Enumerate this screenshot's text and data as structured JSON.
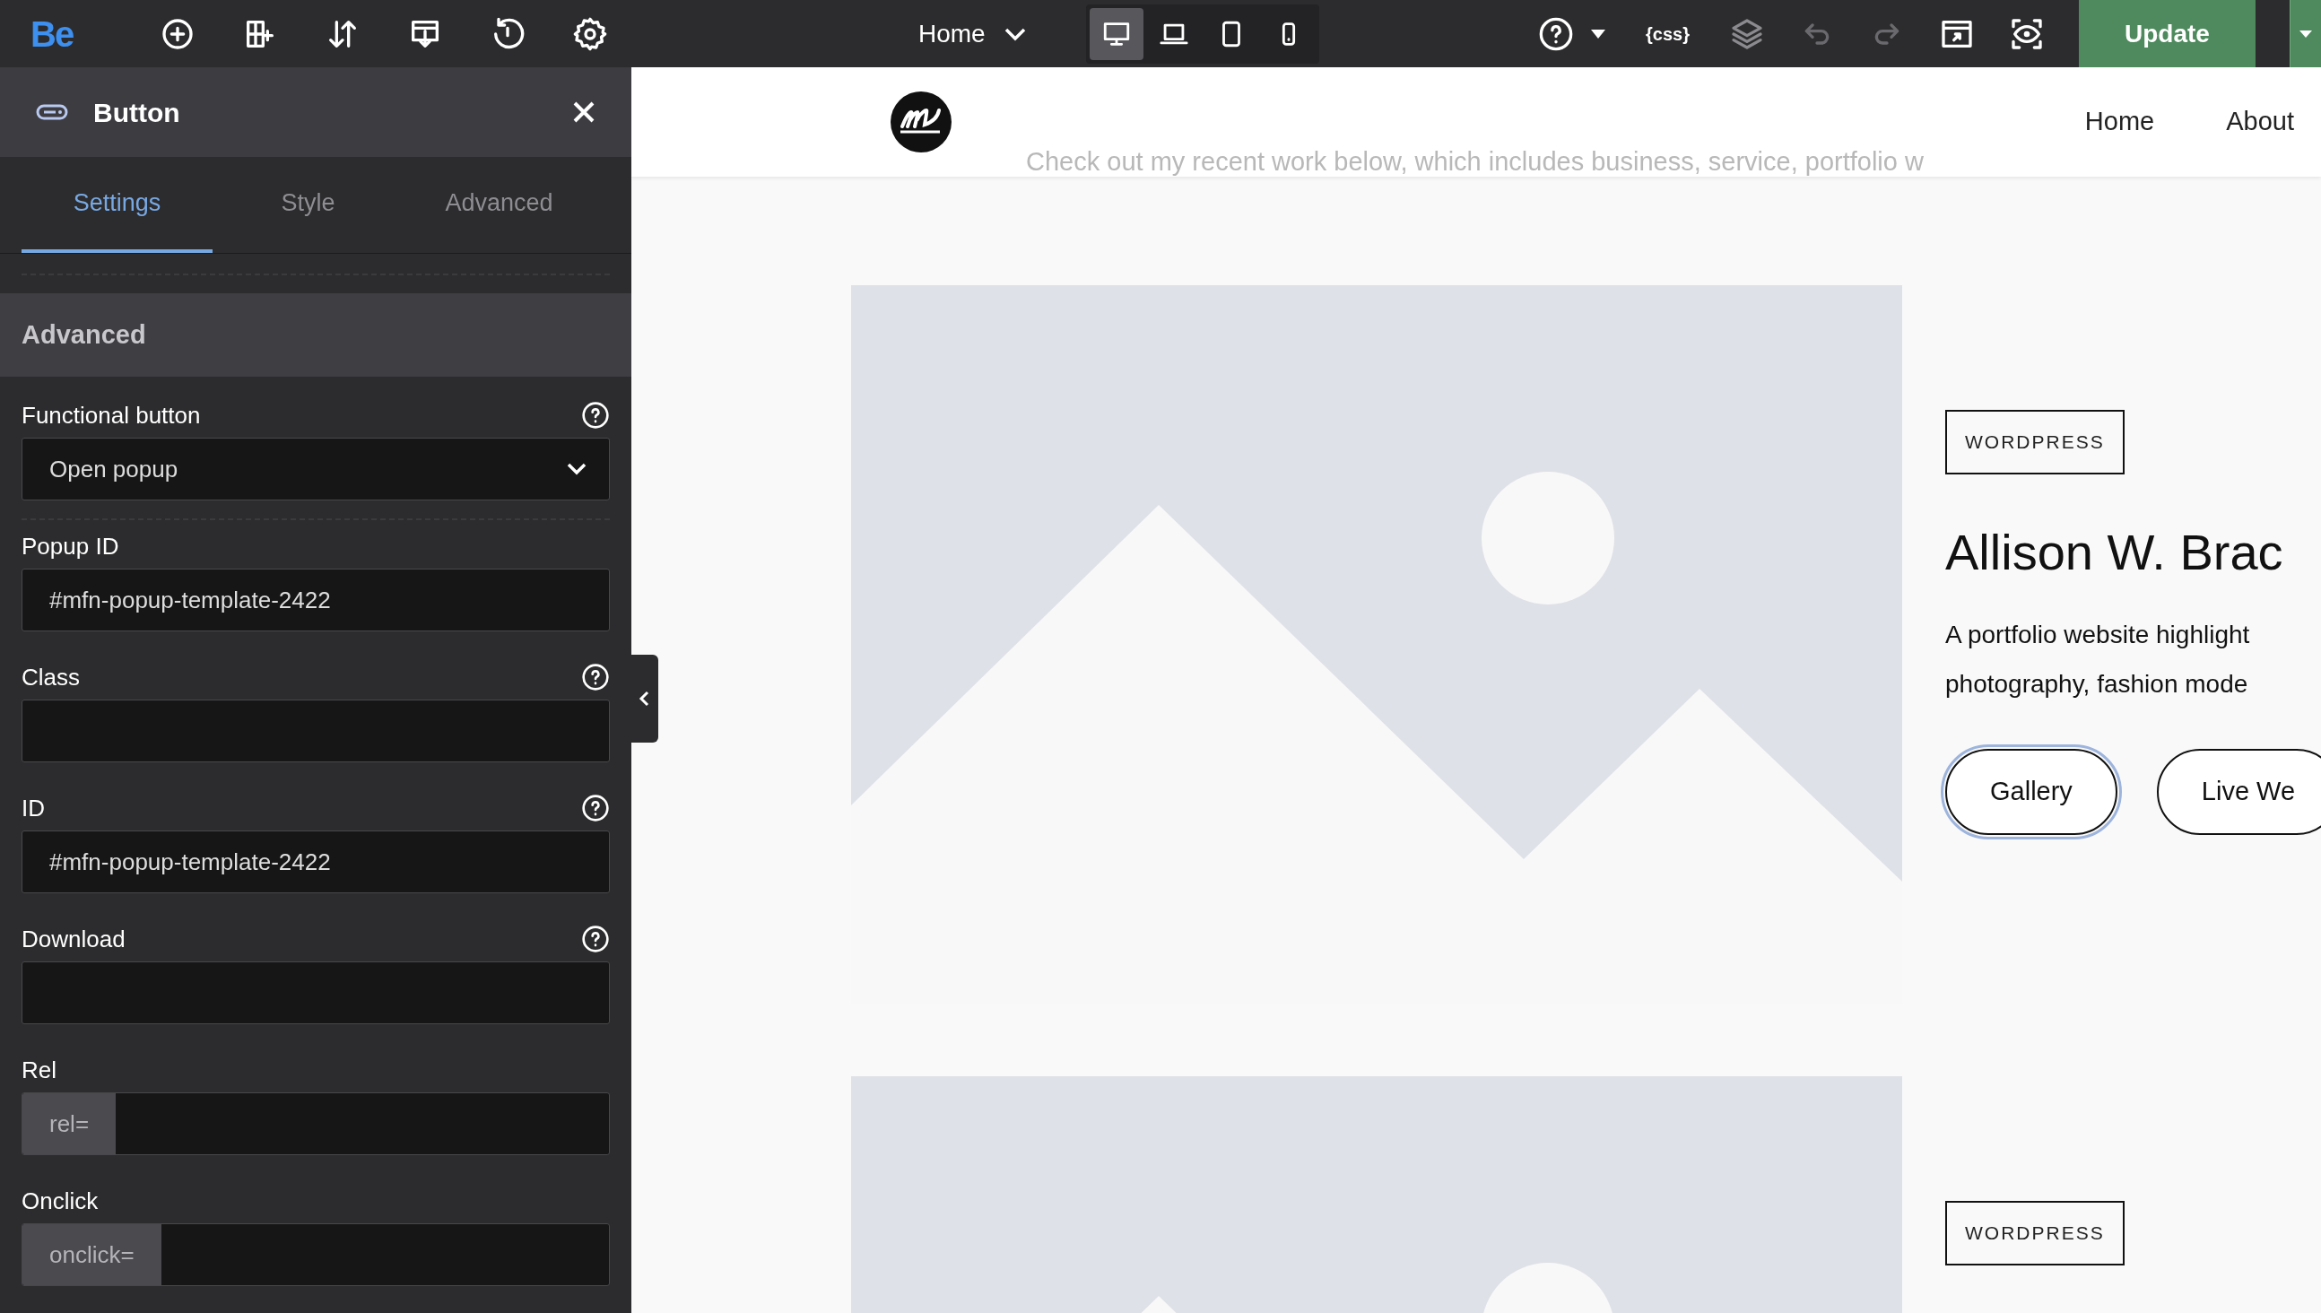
{
  "toolbar": {
    "logo": "Be",
    "tools": [
      {
        "kind": "add"
      },
      {
        "kind": "layout"
      },
      {
        "kind": "sort"
      },
      {
        "kind": "templates"
      },
      {
        "kind": "history"
      },
      {
        "kind": "settings"
      }
    ],
    "page_selector": "Home",
    "devices": [
      {
        "kind": "desktop",
        "selected": true
      },
      {
        "kind": "laptop",
        "selected": false
      },
      {
        "kind": "tablet",
        "selected": false
      },
      {
        "kind": "mobile",
        "selected": false
      }
    ],
    "css_button": "{css}",
    "history": [
      {
        "kind": "undo",
        "disabled": true
      },
      {
        "kind": "redo",
        "disabled": true
      }
    ],
    "update_button": "Update"
  },
  "panel": {
    "title": "Button",
    "tabs": [
      {
        "label": "Settings",
        "selected": true
      },
      {
        "label": "Style",
        "selected": false
      },
      {
        "label": "Advanced",
        "selected": false
      }
    ],
    "section": "Advanced",
    "fields": [
      {
        "kind": "select",
        "label": "Functional button",
        "help": true,
        "value": "Open popup"
      },
      {
        "kind": "text",
        "label": "Popup ID",
        "help": false,
        "value": "#mfn-popup-template-2422"
      },
      {
        "kind": "text",
        "label": "Class",
        "help": true
      },
      {
        "kind": "text",
        "label": "ID",
        "help": true,
        "value": "#mfn-popup-template-2422"
      },
      {
        "kind": "text",
        "label": "Download",
        "help": true
      },
      {
        "kind": "prefixed",
        "label": "Rel",
        "help": false,
        "prefix": "rel="
      },
      {
        "kind": "prefixed",
        "label": "Onclick",
        "help": false,
        "prefix": "onclick="
      }
    ]
  },
  "preview": {
    "nav": [
      "Home",
      "About"
    ],
    "intro": "Check out my recent work below, which includes business, service, portfolio w",
    "projects": [
      {
        "tag": "WORDPRESS",
        "title": "Allison W. Brac",
        "description": [
          "A portfolio website highlight",
          "photography, fashion mode"
        ],
        "buttons": [
          {
            "label": "Gallery",
            "selected": true
          },
          {
            "label": "Live We",
            "selected": false
          }
        ]
      },
      {
        "tag": "WORDPRESS"
      }
    ]
  }
}
